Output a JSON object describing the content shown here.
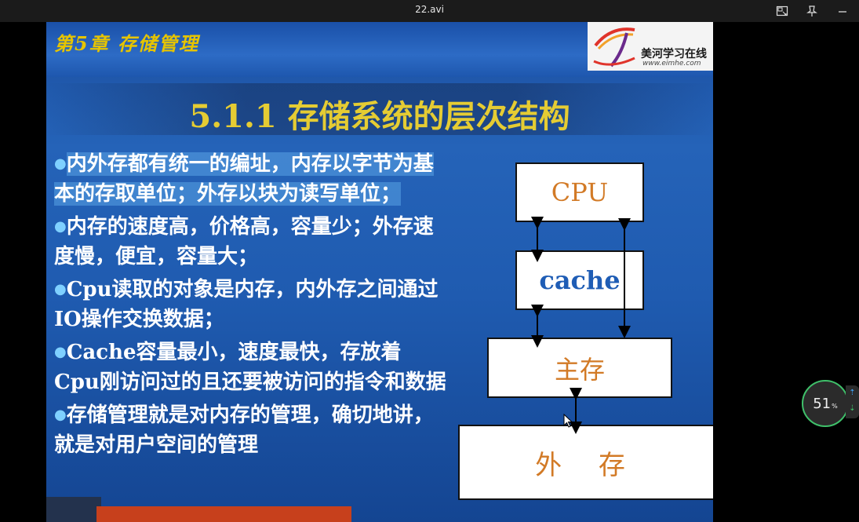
{
  "window": {
    "title": "22.avi"
  },
  "slide": {
    "chapter": "第5章  存储管理",
    "logo": {
      "name": "美河学习在线",
      "url": "www.eimhe.com"
    },
    "title": "5.1.1 存储系统的层次结构",
    "bullets": [
      "内外存都有统一的编址，内存以字节为基本的存取单位；外存以块为读写单位；",
      "内存的速度高，价格高，容量少；外存速度慢，便宜，容量大；",
      "Cpu读取的对象是内存，内外存之间通过IO操作交换数据；",
      "Cache容量最小，速度最快，存放着Cpu刚访问过的且还要被访问的指令和数据",
      "存储管理就是对内存的管理，确切地讲，就是对用户空间的管理"
    ],
    "diagram": {
      "cpu": "CPU",
      "cache": "cache",
      "main_memory": "主存",
      "external": "外 存"
    }
  },
  "playback": {
    "speed": "51",
    "speed_unit": "%"
  },
  "icons": [
    "picture-in-picture-icon",
    "pin-icon",
    "minimize-icon",
    "speed-up-icon",
    "speed-down-icon"
  ]
}
